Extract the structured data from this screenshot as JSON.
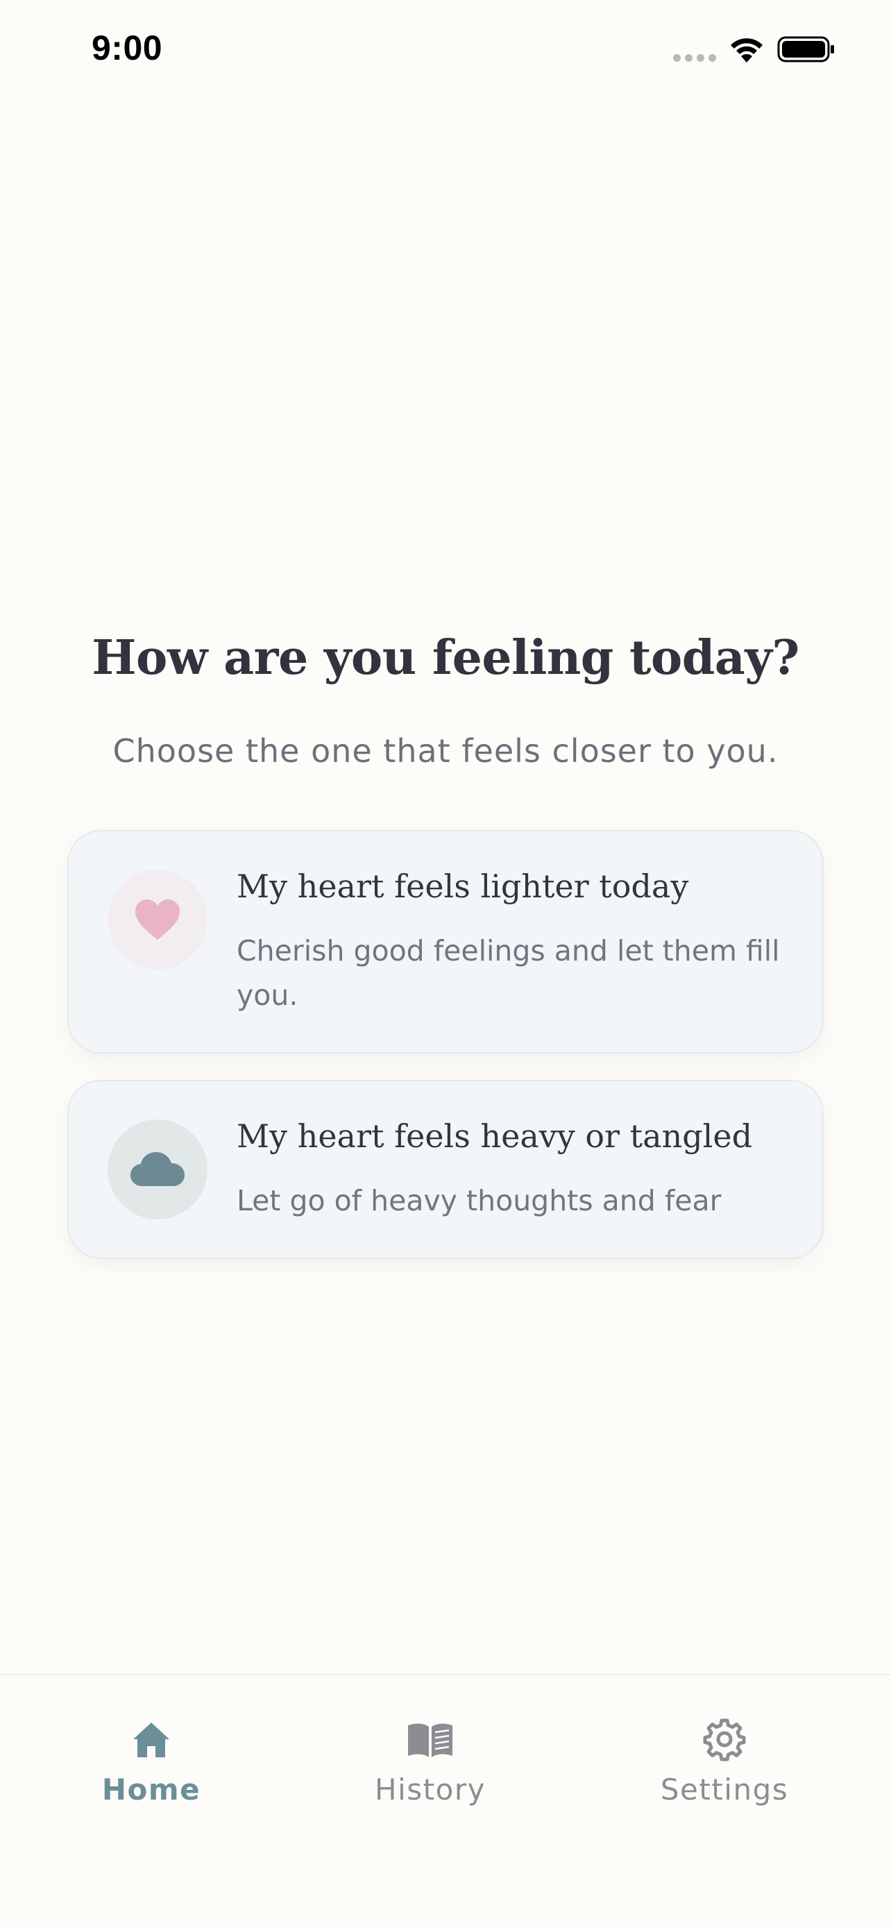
{
  "status_bar": {
    "time": "9:00"
  },
  "main": {
    "title": "How are you feeling today?",
    "subtitle": "Choose the one that feels closer to you.",
    "options": [
      {
        "icon": "heart-icon",
        "title": "My heart feels lighter today",
        "description": "Cherish good feelings and let them fill you."
      },
      {
        "icon": "cloud-icon",
        "title": "My heart feels heavy or tangled",
        "description": "Let go of heavy thoughts and fear"
      }
    ]
  },
  "bottom_nav": {
    "items": [
      {
        "label": "Home",
        "icon": "home-icon",
        "active": true
      },
      {
        "label": "History",
        "icon": "book-icon",
        "active": false
      },
      {
        "label": "Settings",
        "icon": "gear-icon",
        "active": false
      }
    ]
  },
  "colors": {
    "background": "#fdfcf9",
    "accent": "#6a8f98",
    "heart": "#e8b4c6",
    "cloud": "#6b8a93",
    "card": "#f3f6f9"
  }
}
